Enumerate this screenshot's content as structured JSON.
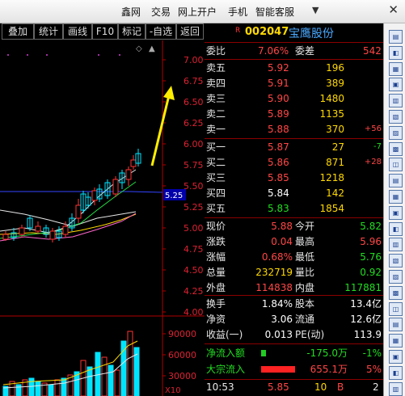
{
  "topbar": {
    "menu": [
      "鑫网",
      "交易",
      "网上开户",
      "手机",
      "智能客服"
    ],
    "close_icon": "close-icon"
  },
  "toolbar": {
    "buttons": [
      "叠加",
      "统计",
      "画线",
      "F10",
      "标记",
      "-自选",
      "返回"
    ]
  },
  "chart": {
    "price_ticks": [
      "7.00",
      "6.75",
      "6.50",
      "6.25",
      "6.00",
      "5.75",
      "5.50",
      "5.25",
      "5.00",
      "4.75",
      "4.50",
      "4.25",
      "4.00"
    ],
    "current_price_label": "5.25",
    "volume_ticks": [
      "90000",
      "60000",
      "30000"
    ],
    "volume_unit": "X10",
    "arrow_color": "#ffee00",
    "up_color": "#00e5ff",
    "down_color": "#ff3333"
  },
  "quote": {
    "badge": "R",
    "code": "002047",
    "name": "宝鹰股份",
    "weibi_label": "委比",
    "weibi_value": "7.06%",
    "weicha_label": "委差",
    "weicha_value": "542",
    "asks": [
      {
        "label": "卖五",
        "price": "5.92",
        "vol": "196",
        "delta": ""
      },
      {
        "label": "卖四",
        "price": "5.91",
        "vol": "389",
        "delta": ""
      },
      {
        "label": "卖三",
        "price": "5.90",
        "vol": "1480",
        "delta": ""
      },
      {
        "label": "卖二",
        "price": "5.89",
        "vol": "1135",
        "delta": ""
      },
      {
        "label": "卖一",
        "price": "5.88",
        "vol": "370",
        "delta": "+56"
      }
    ],
    "bids": [
      {
        "label": "买一",
        "price": "5.87",
        "vol": "27",
        "delta": "-7"
      },
      {
        "label": "买二",
        "price": "5.86",
        "vol": "871",
        "delta": "+28"
      },
      {
        "label": "买三",
        "price": "5.85",
        "vol": "1218",
        "delta": ""
      },
      {
        "label": "买四",
        "price": "5.84",
        "vol": "142",
        "delta": ""
      },
      {
        "label": "买五",
        "price": "5.83",
        "vol": "1854",
        "delta": ""
      }
    ],
    "stats": [
      {
        "l1": "现价",
        "v1": "5.88",
        "l2": "今开",
        "v2": "5.82"
      },
      {
        "l1": "涨跌",
        "v1": "0.04",
        "l2": "最高",
        "v2": "5.96"
      },
      {
        "l1": "涨幅",
        "v1": "0.68%",
        "l2": "最低",
        "v2": "5.76"
      },
      {
        "l1": "总量",
        "v1": "232719",
        "l2": "量比",
        "v2": "0.92"
      },
      {
        "l1": "外盘",
        "v1": "114838",
        "l2": "内盘",
        "v2": "117881"
      }
    ],
    "stats2": [
      {
        "l1": "换手",
        "v1": "1.84%",
        "l2": "股本",
        "v2": "13.4亿"
      },
      {
        "l1": "净资",
        "v1": "3.06",
        "l2": "流通",
        "v2": "12.6亿"
      },
      {
        "l1": "收益(一)",
        "v1": "0.013",
        "l2": "PE(动)",
        "v2": "113.9"
      }
    ],
    "flow": [
      {
        "label": "净流入额",
        "value": "-175.0万",
        "pct": "-1%",
        "bar_fraction": 0.1,
        "bar_color": "#22cc22"
      },
      {
        "label": "大宗流入",
        "value": "655.1万",
        "pct": "5%",
        "bar_fraction": 0.7,
        "bar_color": "#ff2222"
      }
    ],
    "tick": {
      "time": "10:53",
      "price": "5.85",
      "vol": "10",
      "side": "B",
      "count": "2"
    }
  },
  "side_icons": [
    "icon-a",
    "icon-b",
    "icon-c",
    "icon-d",
    "icon-e",
    "icon-f",
    "icon-g",
    "icon-h",
    "icon-i",
    "icon-j",
    "icon-k",
    "icon-l",
    "icon-m",
    "icon-n",
    "icon-o",
    "icon-p",
    "icon-q",
    "icon-r",
    "icon-s",
    "icon-t",
    "icon-u",
    "icon-v",
    "icon-w"
  ]
}
